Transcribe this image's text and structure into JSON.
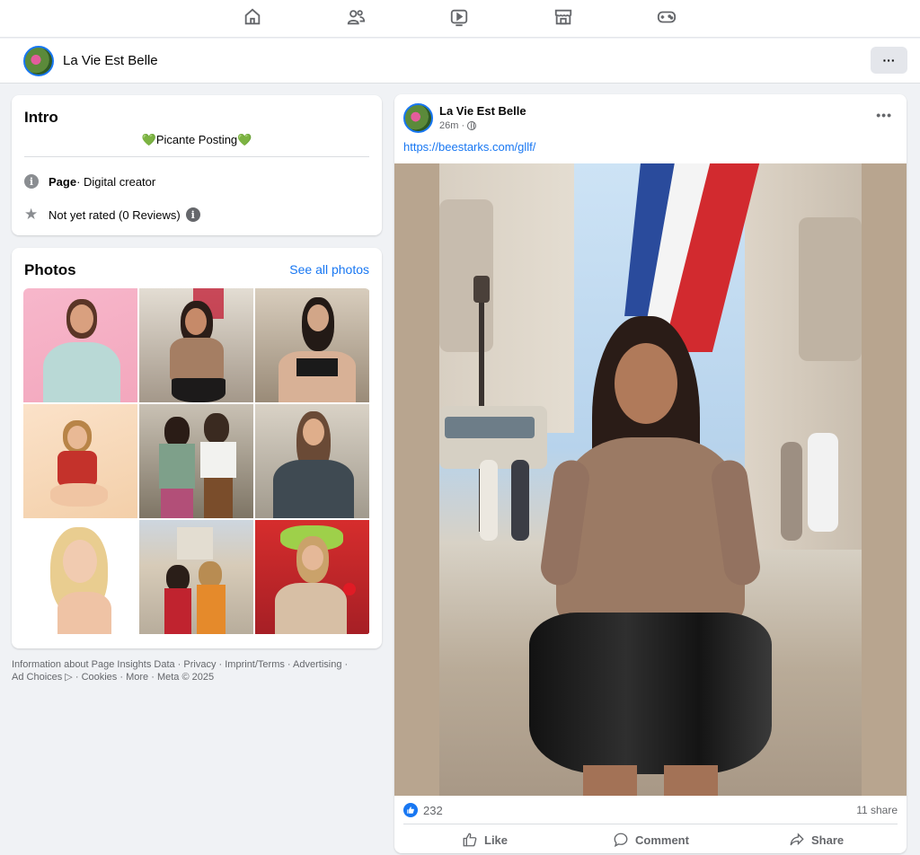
{
  "nav": {
    "icons": [
      "home-icon",
      "friends-icon",
      "video-icon",
      "marketplace-icon",
      "gaming-icon"
    ]
  },
  "page": {
    "name": "La Vie Est Belle",
    "more_label": "···"
  },
  "intro": {
    "title": "Intro",
    "bio": "💚Picante Posting💚",
    "page_type_bold": "Page",
    "page_type_rest": " · Digital creator",
    "rating": "Not yet rated (0 Reviews)"
  },
  "photos": {
    "title": "Photos",
    "see_all": "See all photos",
    "count": 9
  },
  "footer": {
    "line1": [
      "Information about Page Insights Data",
      "Privacy",
      "Imprint/Terms",
      "Advertising"
    ],
    "line2": [
      "Ad Choices ▷",
      "Cookies",
      "More",
      "Meta © 2025"
    ]
  },
  "post": {
    "author": "La Vie Est Belle",
    "time": "26m ·",
    "link": "https://beestarks.com/gllf/",
    "reaction_count": "232",
    "shares": "11 share",
    "actions": {
      "like": "Like",
      "comment": "Comment",
      "share": "Share"
    }
  },
  "colors": {
    "accent": "#1877f2",
    "background": "#f0f2f5",
    "muted_text": "#65676b"
  }
}
